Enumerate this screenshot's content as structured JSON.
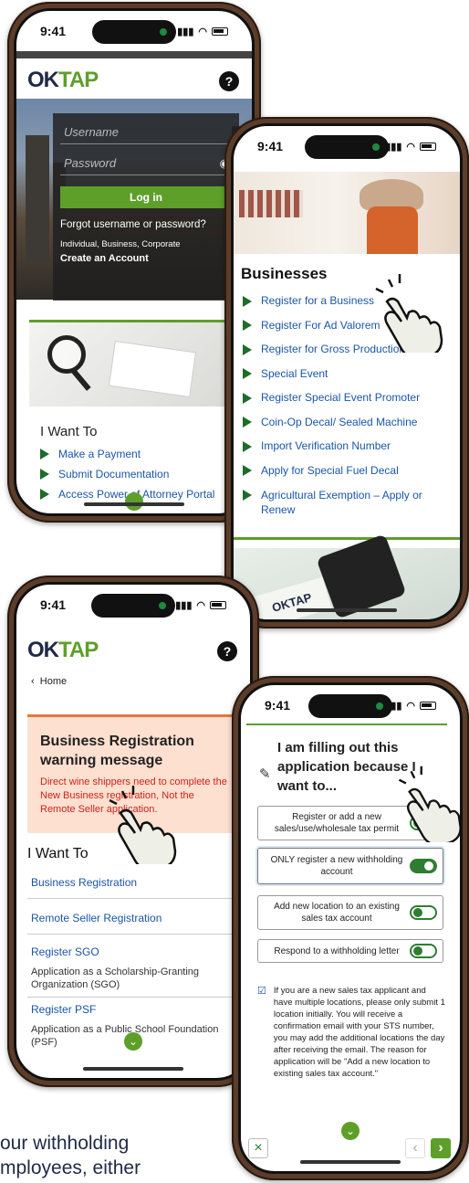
{
  "status_time": "9:41",
  "phone1": {
    "logo_prefix": "OK",
    "logo_accent": "TAP",
    "username_placeholder": "Username",
    "password_placeholder": "Password",
    "login_button": "Log in",
    "forgot_link": "Forgot username or password?",
    "account_types": "Individual, Business, Corporate",
    "create_account": "Create an Account",
    "want_heading": "I Want To",
    "want_items": [
      "Make a Payment",
      "Submit Documentation",
      "Access Power of Attorney Portal"
    ]
  },
  "phone2": {
    "heading": "Businesses",
    "items": [
      "Register for a Business",
      "Register For Ad Valorem",
      "Register for Gross Production",
      "Special Event",
      "Register Special Event Promoter",
      "Coin-Op Decal/ Sealed Machine",
      "Import Verification Number",
      "Apply for Special Fuel Decal",
      "Agricultural Exemption – Apply or Renew"
    ],
    "photo_logo": "OKTAP"
  },
  "phone3": {
    "logo_prefix": "OK",
    "logo_accent": "TAP",
    "back_label": "Home",
    "warning_title": "Business Registration warning message",
    "warning_text": "Direct wine shippers need to complete the New Business registration, Not the Remote Seller application.",
    "want_heading": "I Want To",
    "links": [
      {
        "label": "Business Registration",
        "desc": ""
      },
      {
        "label": "Remote Seller Registration",
        "desc": ""
      },
      {
        "label": "Register SGO",
        "desc": "Application as a Scholarship-Granting Organization (SGO)"
      },
      {
        "label": "Register PSF",
        "desc": "Application as a Public School Foundation (PSF)"
      }
    ]
  },
  "phone4": {
    "title": "I am filling out this application because I want to...",
    "options": [
      {
        "label": "Register or add a new sales/use/wholesale tax permit",
        "on": false
      },
      {
        "label": "ONLY register a new withholding account",
        "on": true
      },
      {
        "label": "Add new location to an existing sales tax account",
        "on": false
      },
      {
        "label": "Respond to a withholding letter",
        "on": false
      }
    ],
    "note": "If you are a new sales tax applicant and have multiple locations, please only submit 1 location initially. You will receive a confirmation email with your STS number, you may add the additional locations the day after receiving the email. The reason for application will be \"Add a new location to existing sales tax account.\"",
    "close_symbol": "×",
    "prev_symbol": "‹",
    "next_symbol": "›"
  },
  "background_text": {
    "line1": "our withholding",
    "line2": "mployees, either"
  },
  "colors": {
    "green": "#5e9f2a",
    "dark_green": "#1f6b2a",
    "link_blue": "#1a56a8",
    "warning_bg": "#fde0cf",
    "frame": "#5b3d2a"
  }
}
